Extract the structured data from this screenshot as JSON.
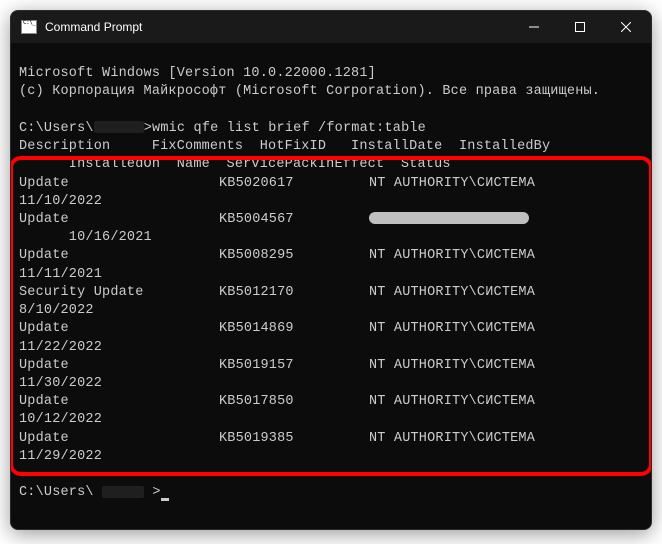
{
  "window": {
    "title": "Command Prompt"
  },
  "header": {
    "line1": "Microsoft Windows [Version 10.0.22000.1281]",
    "line2": "(c) Корпорация Майкрософт (Microsoft Corporation). Все права защищены."
  },
  "prompt": {
    "prefix": "C:\\Users\\",
    "command": "wmic qfe list brief /format:table"
  },
  "columns": {
    "line1": "Description     FixComments  HotFixID   InstallDate  InstalledBy",
    "line2": "      InstalledOn  Name  ServicePackInEffect  Status"
  },
  "rows": [
    {
      "desc": "Update",
      "hotfix": "KB5020617",
      "by": "NT AUTHORITY\\СИСТЕМА",
      "date": "11/10/2022",
      "redacted_by": false
    },
    {
      "desc": "Update",
      "hotfix": "KB5004567",
      "by": "",
      "date": "      10/16/2021",
      "redacted_by": true
    },
    {
      "desc": "Update",
      "hotfix": "KB5008295",
      "by": "NT AUTHORITY\\СИСТЕМА",
      "date": "11/11/2021",
      "redacted_by": false
    },
    {
      "desc": "Security Update",
      "hotfix": "KB5012170",
      "by": "NT AUTHORITY\\СИСТЕМА",
      "date": "8/10/2022",
      "redacted_by": false
    },
    {
      "desc": "Update",
      "hotfix": "KB5014869",
      "by": "NT AUTHORITY\\СИСТЕМА",
      "date": "11/22/2022",
      "redacted_by": false
    },
    {
      "desc": "Update",
      "hotfix": "KB5019157",
      "by": "NT AUTHORITY\\СИСТЕМА",
      "date": "11/30/2022",
      "redacted_by": false
    },
    {
      "desc": "Update",
      "hotfix": "KB5017850",
      "by": "NT AUTHORITY\\СИСТЕМА",
      "date": "10/12/2022",
      "redacted_by": false
    },
    {
      "desc": "Update",
      "hotfix": "KB5019385",
      "by": "NT AUTHORITY\\СИСТЕМА",
      "date": "11/29/2022",
      "redacted_by": false
    }
  ],
  "prompt2": {
    "prefix": "C:\\Users\\",
    "suffix": ">"
  }
}
